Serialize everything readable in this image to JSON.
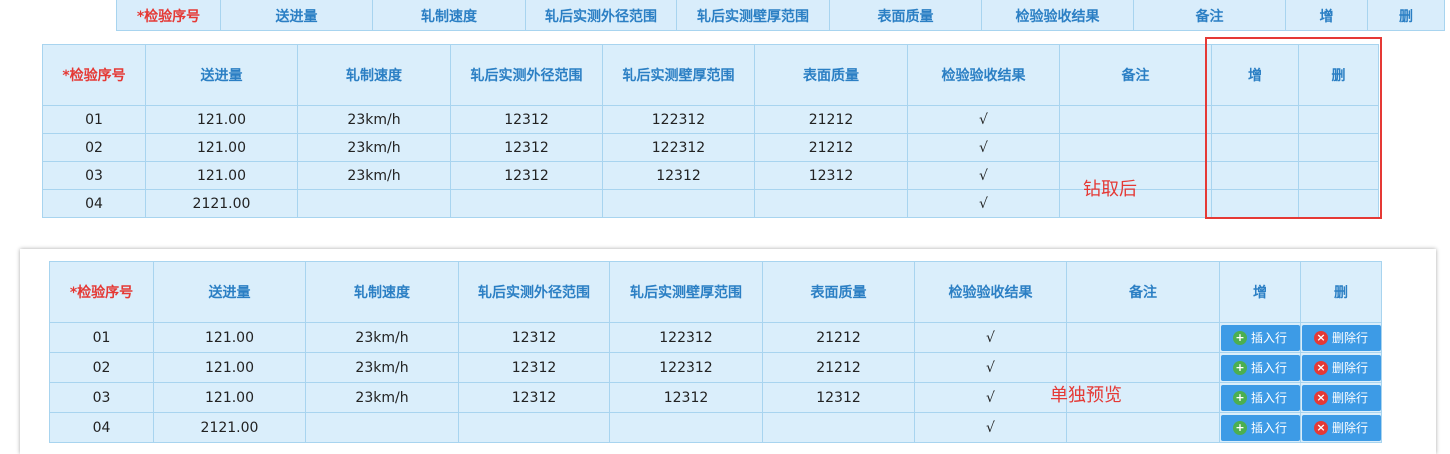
{
  "columns": [
    "*检验序号",
    "送进量",
    "轧制速度",
    "轧后实测外径范围",
    "轧后实测壁厚范围",
    "表面质量",
    "检验验收结果",
    "备注",
    "增",
    "删"
  ],
  "rows": [
    [
      "01",
      "121.00",
      "23km/h",
      "12312",
      "122312",
      "21212",
      "√",
      ""
    ],
    [
      "02",
      "121.00",
      "23km/h",
      "12312",
      "122312",
      "21212",
      "√",
      ""
    ],
    [
      "03",
      "121.00",
      "23km/h",
      "12312",
      "12312",
      "12312",
      "√",
      ""
    ],
    [
      "04",
      "2121.00",
      "",
      "",
      "",
      "",
      "√",
      ""
    ]
  ],
  "annotations": {
    "after_drill": "钻取后",
    "standalone_preview": "单独预览"
  },
  "buttons": {
    "insert_row": "插入行",
    "delete_row": "删除行"
  },
  "colors": {
    "header_text": "#2b7fc4",
    "required_text": "#e53935",
    "table_bg": "#daeefb",
    "border": "#a8d4ef",
    "button_bg": "#3d9be6",
    "highlight": "#e53935"
  },
  "icons": [
    "plus-circle-icon",
    "close-circle-icon"
  ]
}
